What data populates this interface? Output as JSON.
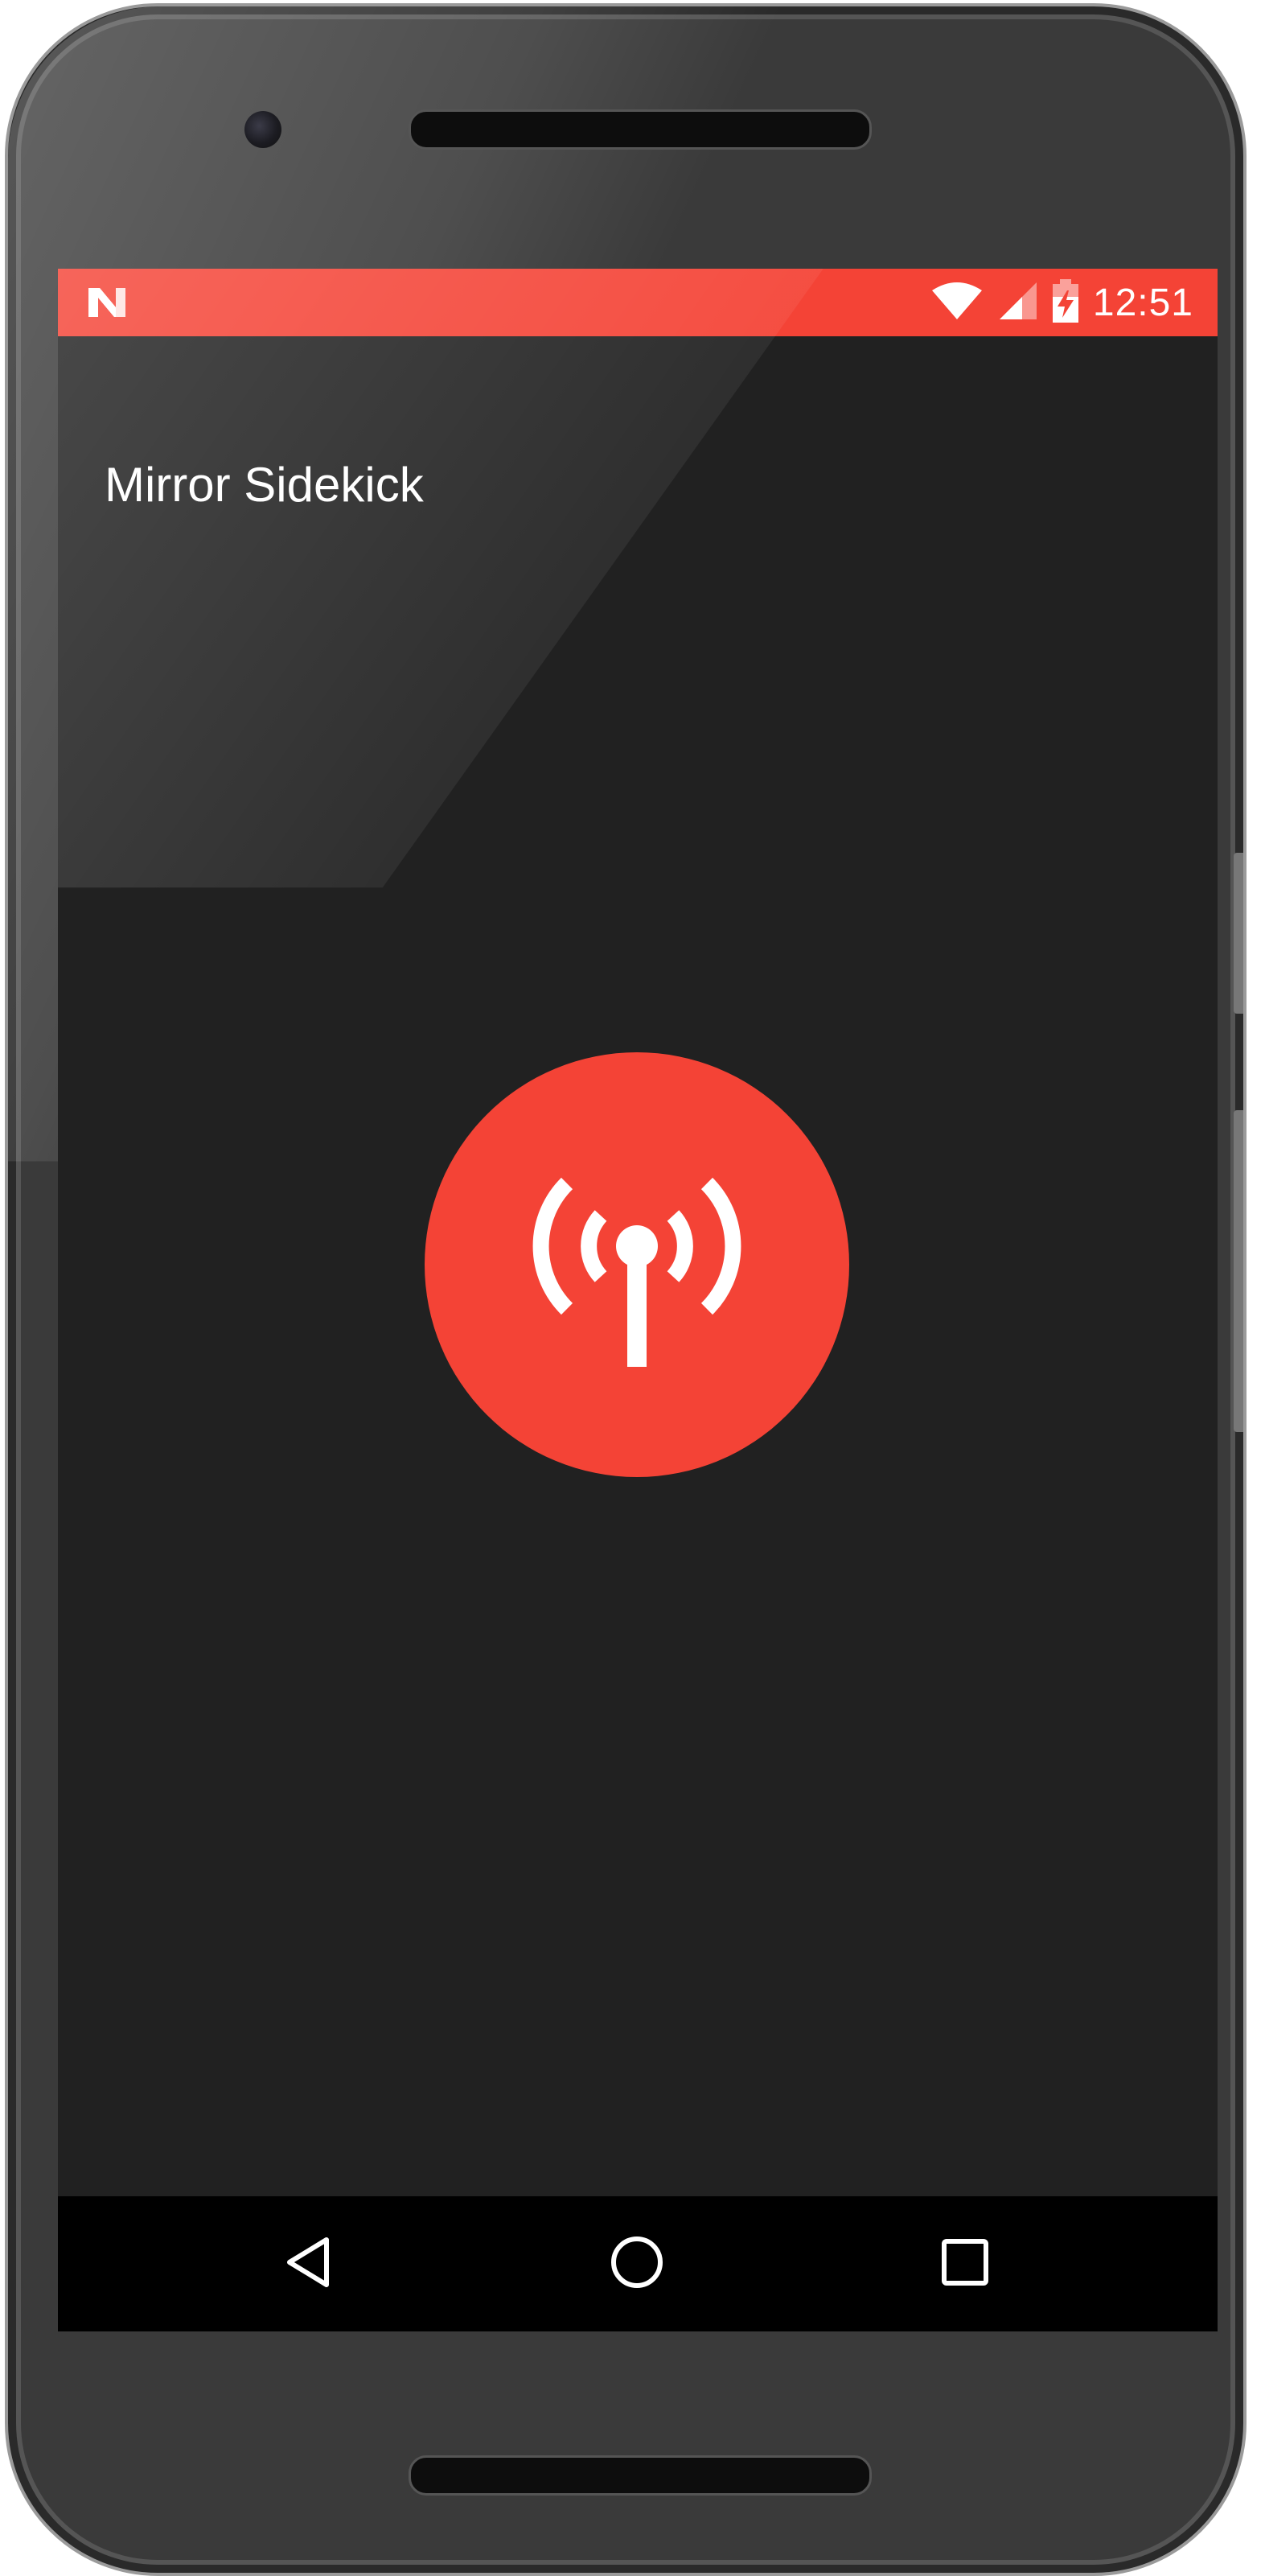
{
  "status_bar": {
    "time": "12:51",
    "color": "#f44336",
    "icons": [
      "notification-n-icon",
      "wifi-icon",
      "cell-signal-icon",
      "battery-charging-icon"
    ]
  },
  "app": {
    "title": "Mirror Sidekick",
    "background": "#212121"
  },
  "main": {
    "action_icon": "broadcast-antenna-icon",
    "accent": "#f44336"
  },
  "nav_bar": {
    "buttons": [
      "back-icon",
      "home-icon",
      "recents-icon"
    ]
  }
}
